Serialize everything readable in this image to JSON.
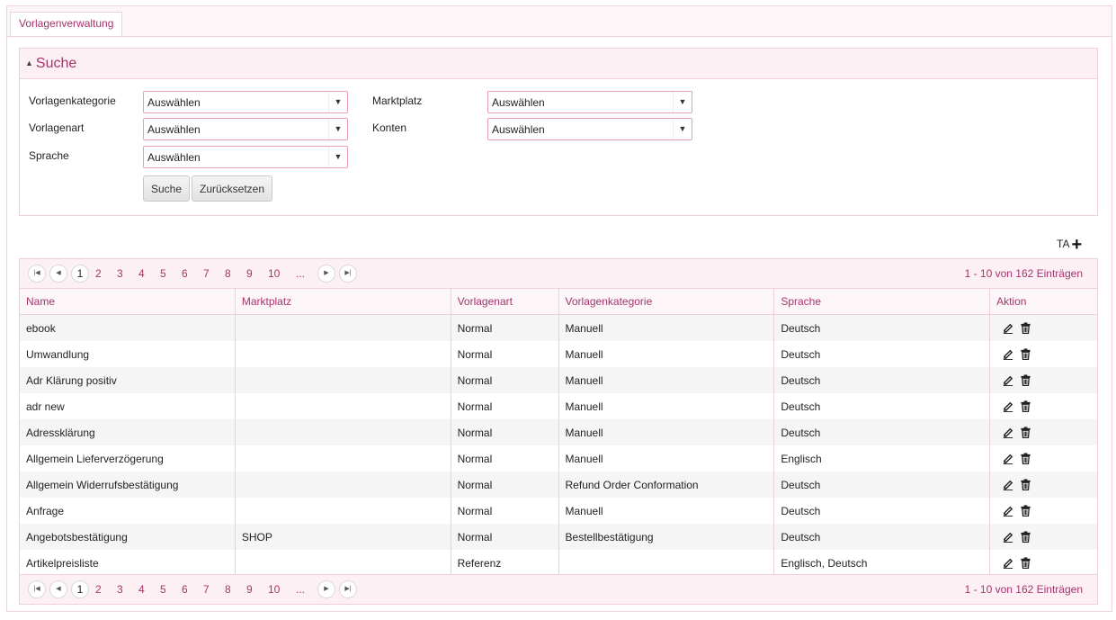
{
  "tab": {
    "label": "Vorlagenverwaltung"
  },
  "search": {
    "title": "Suche",
    "fields": {
      "kategorie": {
        "label": "Vorlagenkategorie",
        "value": "Auswählen"
      },
      "art": {
        "label": "Vorlagenart",
        "value": "Auswählen"
      },
      "sprache": {
        "label": "Sprache",
        "value": "Auswählen"
      },
      "marktplatz": {
        "label": "Marktplatz",
        "value": "Auswählen"
      },
      "konten": {
        "label": "Konten",
        "value": "Auswählen"
      }
    },
    "search_button": "Suche",
    "reset_button": "Zurücksetzen"
  },
  "toolbar": {
    "ta_label": "TA",
    "add_icon": "plus-icon"
  },
  "pager": {
    "pages": [
      "1",
      "2",
      "3",
      "4",
      "5",
      "6",
      "7",
      "8",
      "9",
      "10",
      "..."
    ],
    "current": "1",
    "info": "1 - 10 von 162 Einträgen"
  },
  "table": {
    "columns": [
      "Name",
      "Marktplatz",
      "Vorlagenart",
      "Vorlagenkategorie",
      "Sprache",
      "Aktion"
    ],
    "rows": [
      [
        "ebook",
        "",
        "Normal",
        "Manuell",
        "Deutsch"
      ],
      [
        "Umwandlung",
        "",
        "Normal",
        "Manuell",
        "Deutsch"
      ],
      [
        "Adr Klärung positiv",
        "",
        "Normal",
        "Manuell",
        "Deutsch"
      ],
      [
        "adr new",
        "",
        "Normal",
        "Manuell",
        "Deutsch"
      ],
      [
        "Adressklärung",
        "",
        "Normal",
        "Manuell",
        "Deutsch"
      ],
      [
        "Allgemein Lieferverzögerung",
        "",
        "Normal",
        "Manuell",
        "Englisch"
      ],
      [
        "Allgemein Widerrufsbestätigung",
        "",
        "Normal",
        "Refund Order Conformation",
        "Deutsch"
      ],
      [
        "Anfrage",
        "",
        "Normal",
        "Manuell",
        "Deutsch"
      ],
      [
        "Angebotsbestätigung",
        "SHOP",
        "Normal",
        "Bestellbestätigung",
        "Deutsch"
      ],
      [
        "Artikelpreisliste",
        "",
        "Referenz",
        "",
        "Englisch, Deutsch"
      ]
    ],
    "action_icons": [
      "edit-icon",
      "trash-icon"
    ]
  },
  "colors": {
    "accent": "#a7336b",
    "border": "#f0cfde",
    "header_bg": "#fdf0f5"
  }
}
